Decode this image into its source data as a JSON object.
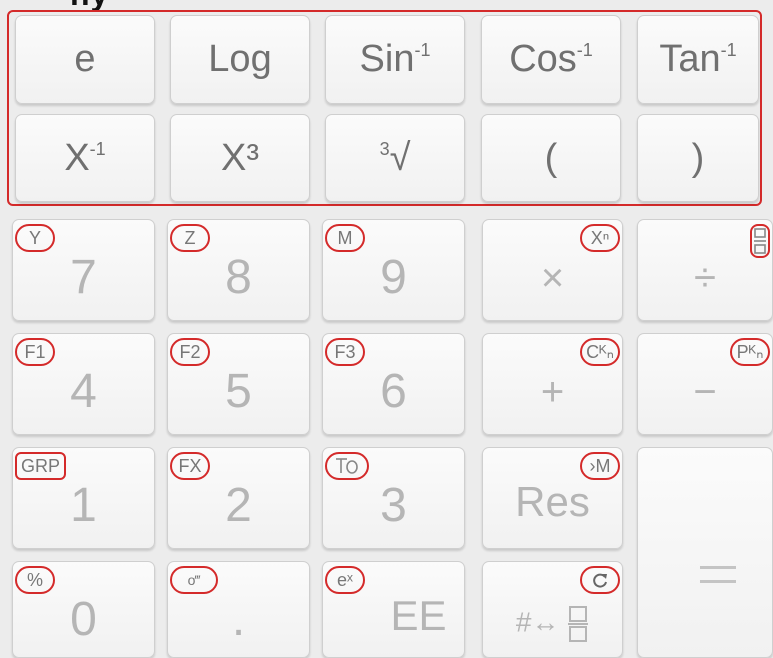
{
  "header": {
    "title": "ny"
  },
  "function_rows": [
    [
      {
        "name": "e-button",
        "label": "e"
      },
      {
        "name": "log-button",
        "label": "Log"
      },
      {
        "name": "arcsin-button",
        "label": "Sin",
        "sup": "-1"
      },
      {
        "name": "arccos-button",
        "label": "Cos",
        "sup": "-1"
      },
      {
        "name": "arctan-button",
        "label": "Tan",
        "sup": "-1"
      }
    ],
    [
      {
        "name": "reciprocal-button",
        "label": "X",
        "sup": "-1"
      },
      {
        "name": "cube-button",
        "label": "X³"
      },
      {
        "name": "cube-root-button",
        "label": "√",
        "sup": "3"
      },
      {
        "name": "open-paren-button",
        "label": "("
      },
      {
        "name": "close-paren-button",
        "label": ")"
      }
    ]
  ],
  "keypad": {
    "k7": {
      "label": "7",
      "secondary": "Y"
    },
    "k8": {
      "label": "8",
      "secondary": "Z"
    },
    "k9": {
      "label": "9",
      "secondary": "M"
    },
    "multiply": {
      "label": "×",
      "secondary": "Xⁿ"
    },
    "divide": {
      "label": "÷"
    },
    "k4": {
      "label": "4",
      "secondary": "F1"
    },
    "k5": {
      "label": "5",
      "secondary": "F2"
    },
    "k6": {
      "label": "6",
      "secondary": "F3"
    },
    "plus": {
      "label": "+",
      "secondary": "Cᴷₙ"
    },
    "minus": {
      "label": "−",
      "secondary": "Pᴷₙ"
    },
    "k1": {
      "label": "1",
      "secondary": "GRP"
    },
    "k2": {
      "label": "2",
      "secondary": "FX"
    },
    "k3": {
      "label": "3"
    },
    "res": {
      "label": "Res",
      "secondary": "›M"
    },
    "equals": {
      "label": "="
    },
    "k0": {
      "label": "0",
      "secondary": "%"
    },
    "dot": {
      "label": ".",
      "secondary": "o‴"
    },
    "ee": {
      "label": "EE",
      "secondary": "eˣ"
    },
    "fraction_toggle": {
      "label": "#↔"
    }
  }
}
